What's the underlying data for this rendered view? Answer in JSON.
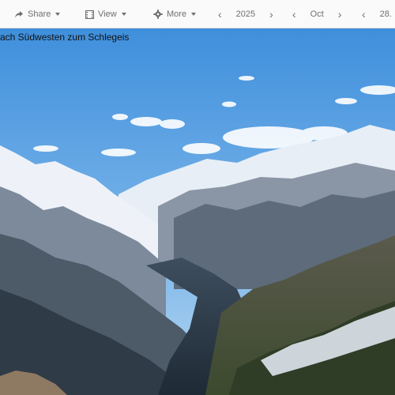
{
  "toolbar": {
    "share_label": "Share",
    "view_label": "View",
    "more_label": "More",
    "year": "2025",
    "month": "Oct",
    "day": "28."
  },
  "icons": {
    "share": "share-icon",
    "view": "film-icon",
    "more": "gear-icon",
    "prev": "chevron-left-icon",
    "next": "chevron-right-icon",
    "dropdown": "caret-down-icon"
  },
  "image": {
    "caption": "ach Südwesten zum Schlegeis"
  },
  "colors": {
    "sky_top": "#3f8fdc",
    "sky_bottom": "#a9d0ef",
    "toolbar_bg": "#fafafa",
    "toolbar_text": "#6f6f6f"
  }
}
